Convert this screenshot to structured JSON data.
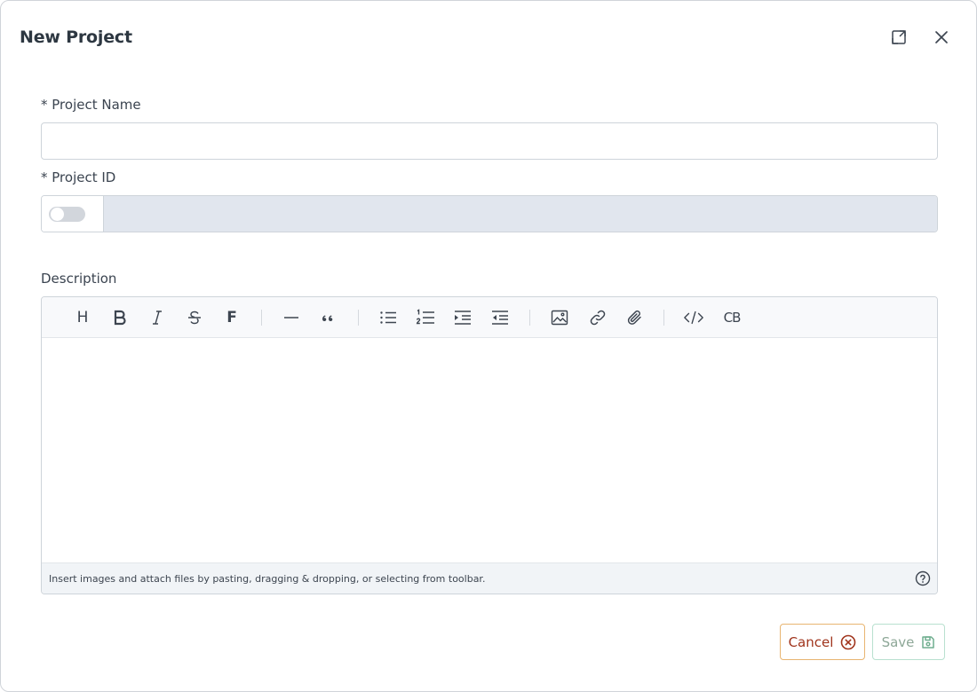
{
  "dialog": {
    "title": "New Project",
    "expand_icon": "expand-icon",
    "close_icon": "close-icon"
  },
  "form": {
    "project_name": {
      "label": "* Project Name",
      "value": "",
      "placeholder": ""
    },
    "project_id": {
      "label": "* Project ID",
      "value": "",
      "placeholder": "",
      "toggle_on": false
    },
    "description": {
      "label": "Description",
      "toolbar": [
        "heading-icon",
        "bold-icon",
        "italic-icon",
        "strikethrough-icon",
        "font-icon",
        "horizontal-rule-icon",
        "quote-icon",
        "bullet-list-icon",
        "numbered-list-icon",
        "indent-icon",
        "outdent-icon",
        "image-icon",
        "link-icon",
        "attachment-icon",
        "code-icon",
        "code-block-icon"
      ],
      "toolbar_text": {
        "heading": "H",
        "font": "F",
        "code_block": "CB"
      },
      "hint": "Insert images and attach files by pasting, dragging & dropping, or selecting from toolbar.",
      "help_icon": "help-circle-icon"
    }
  },
  "actions": {
    "cancel_label": "Cancel",
    "save_label": "Save",
    "cancel_icon": "x-circle-icon",
    "save_icon": "floppy-disk-icon"
  },
  "colors": {
    "cancel_border": "#e8b571",
    "cancel_text": "#a0341c",
    "save_border": "#b8e0cf",
    "save_text": "#8da797",
    "readonly_input_bg": "#e1e6ee"
  }
}
